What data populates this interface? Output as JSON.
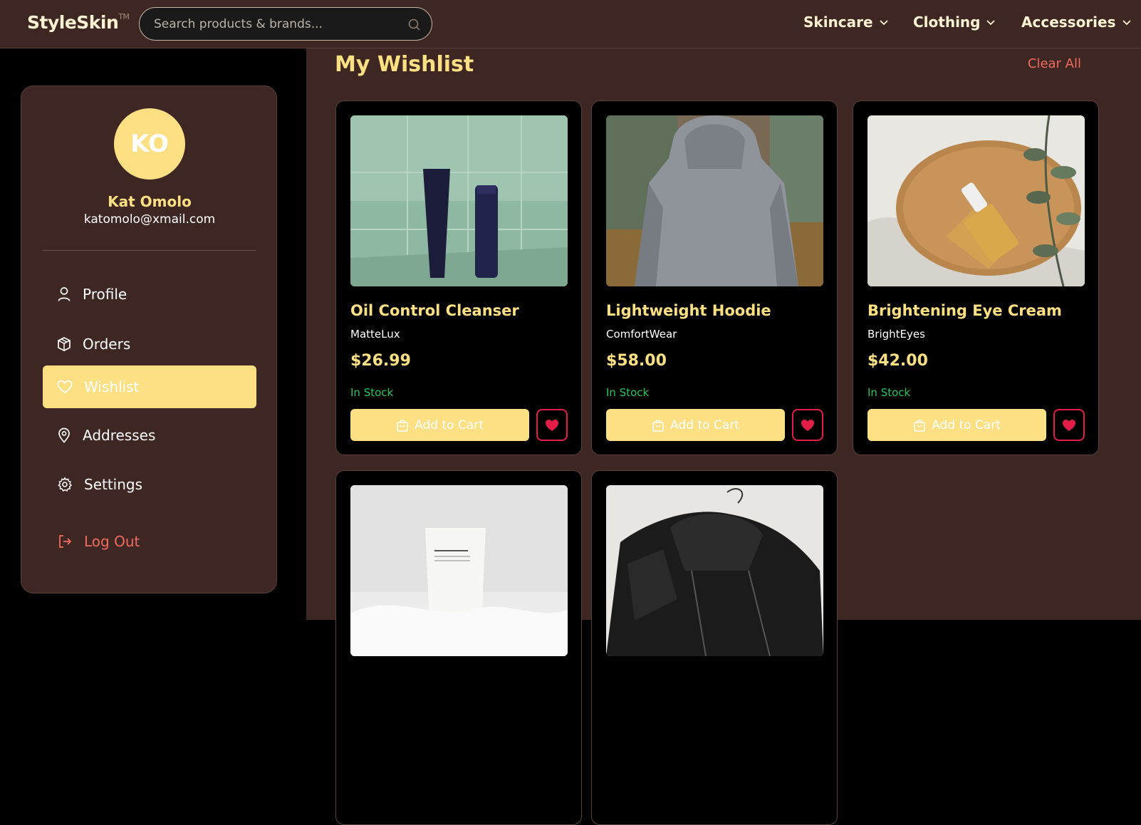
{
  "header": {
    "logo": "StyleSkin",
    "logo_tm": "TM",
    "search_placeholder": "Search products & brands...",
    "nav": [
      {
        "label": "Skincare"
      },
      {
        "label": "Clothing"
      },
      {
        "label": "Accessories"
      }
    ]
  },
  "sidebar": {
    "avatar_initials": "KO",
    "user_name": "Kat Omolo",
    "user_email": "katomolo@xmail.com",
    "menu": [
      {
        "label": "Profile",
        "icon": "user-icon"
      },
      {
        "label": "Orders",
        "icon": "box-icon"
      },
      {
        "label": "Wishlist",
        "icon": "heart-icon",
        "active": true
      },
      {
        "label": "Addresses",
        "icon": "map-pin-icon"
      },
      {
        "label": "Settings",
        "icon": "gear-icon"
      },
      {
        "label": "Log Out",
        "icon": "logout-icon"
      }
    ]
  },
  "main": {
    "title": "My Wishlist",
    "clear_all": "Clear All",
    "add_to_cart_label": "Add to Cart",
    "items": [
      {
        "name": "Oil Control Cleanser",
        "brand": "MatteLux",
        "price": "$26.99",
        "stock": "In Stock"
      },
      {
        "name": "Lightweight Hoodie",
        "brand": "ComfortWear",
        "price": "$58.00",
        "stock": "In Stock"
      },
      {
        "name": "Brightening Eye Cream",
        "brand": "BrightEyes",
        "price": "$42.00",
        "stock": "In Stock"
      },
      {
        "name": "",
        "brand": "",
        "price": "",
        "stock": ""
      },
      {
        "name": "",
        "brand": "",
        "price": "",
        "stock": ""
      }
    ]
  },
  "colors": {
    "accent": "#fde084",
    "panel": "#3e2723",
    "danger": "#f06b5f",
    "in_stock": "#22c55e",
    "heart": "#e11d48"
  }
}
